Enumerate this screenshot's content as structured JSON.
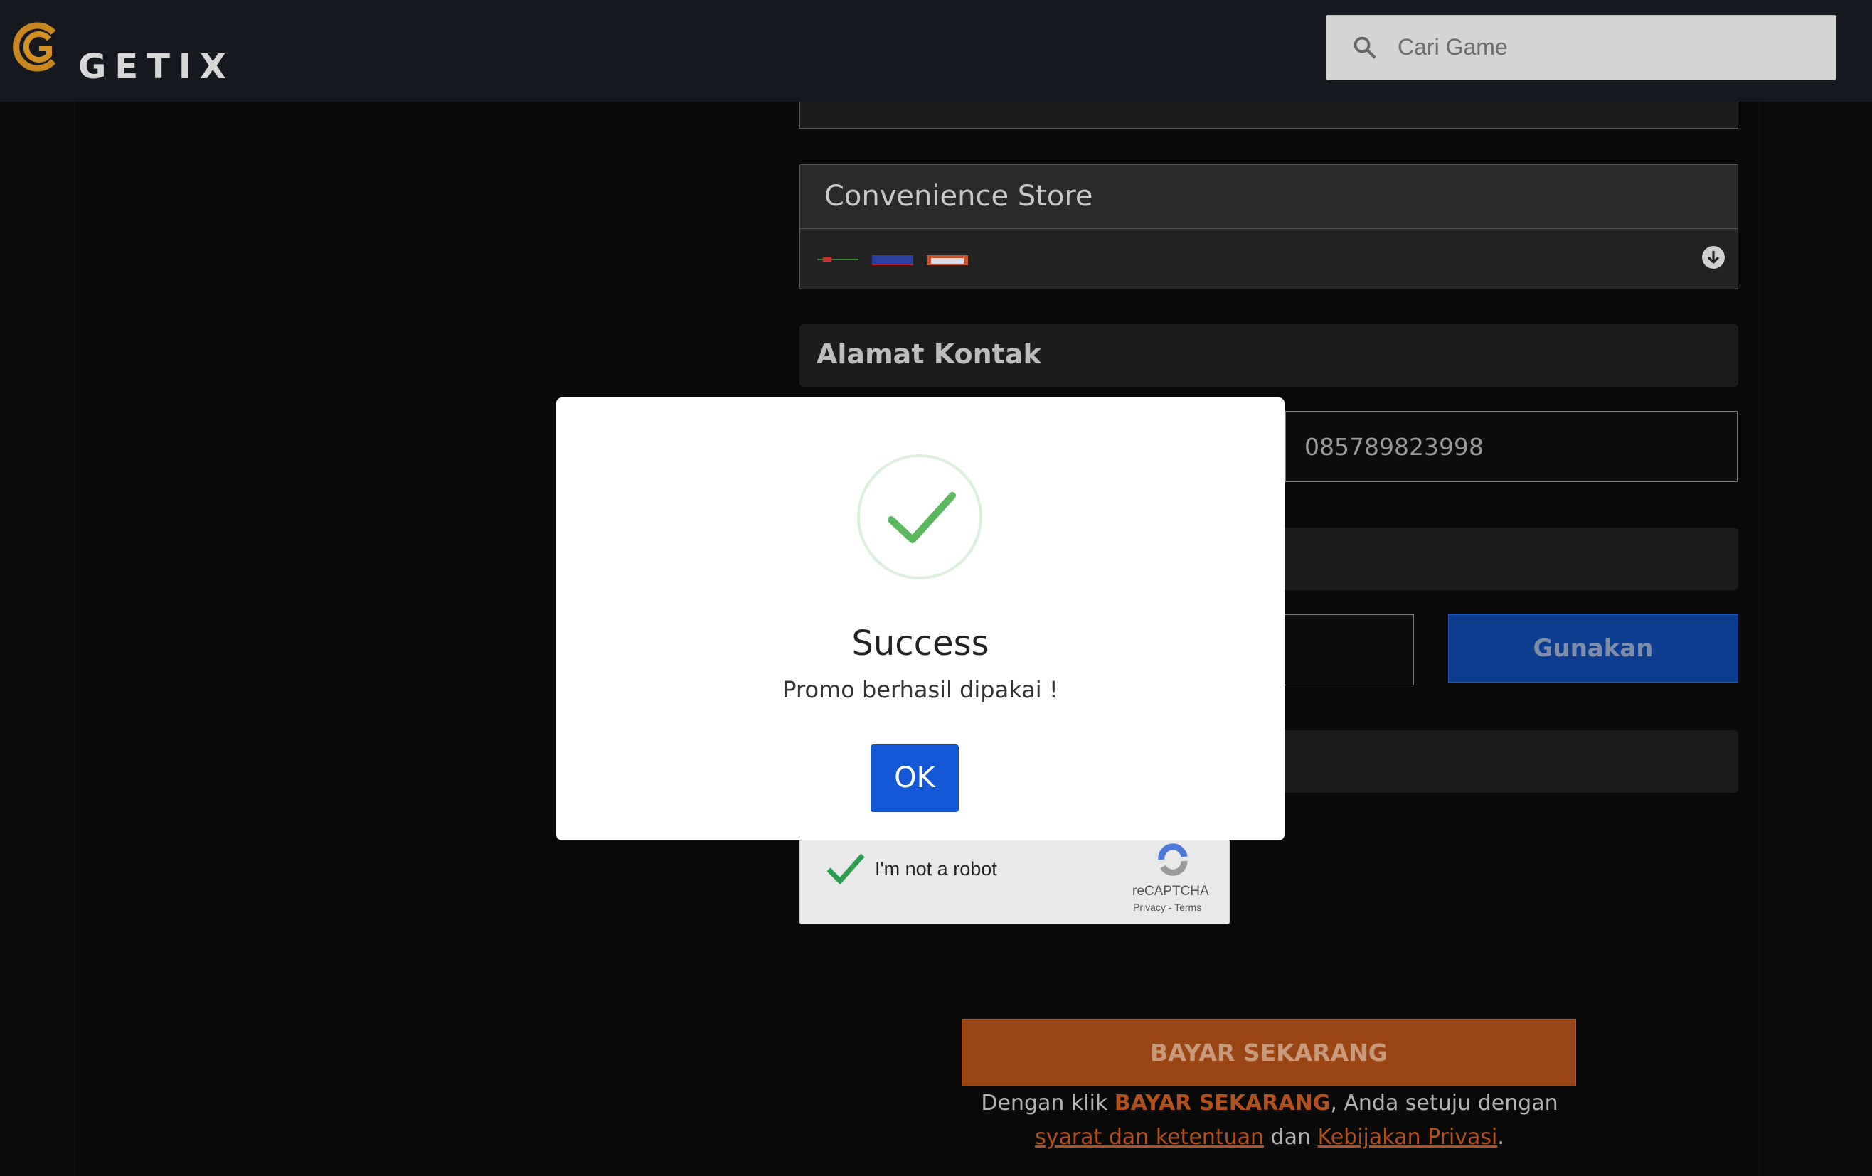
{
  "header": {
    "logo_text": "GETIX",
    "search_placeholder": "Cari Game"
  },
  "payment": {
    "store_label": "Convenience Store"
  },
  "contact": {
    "section_title": "Alamat Kontak",
    "phone_value": "085789823998"
  },
  "promo": {
    "apply_label": "Gunakan"
  },
  "captcha": {
    "label": "I'm not a robot",
    "brand": "reCAPTCHA",
    "links": "Privacy - Terms"
  },
  "checkout": {
    "pay_label": "BAYAR SEKARANG",
    "terms_prefix": "Dengan klik ",
    "terms_bold": "BAYAR SEKARANG",
    "terms_mid": ", Anda setuju dengan ",
    "terms_link1": "syarat dan ketentuan",
    "terms_and": " dan ",
    "terms_link2": "Kebijakan Privasi",
    "terms_end": "."
  },
  "modal": {
    "title": "Success",
    "message": "Promo berhasil dipakai !",
    "ok_label": "OK",
    "icon": "success-check-icon"
  },
  "colors": {
    "accent_orange": "#c55a1b",
    "accent_blue": "#1558d6",
    "success_green": "#5cb85c"
  }
}
